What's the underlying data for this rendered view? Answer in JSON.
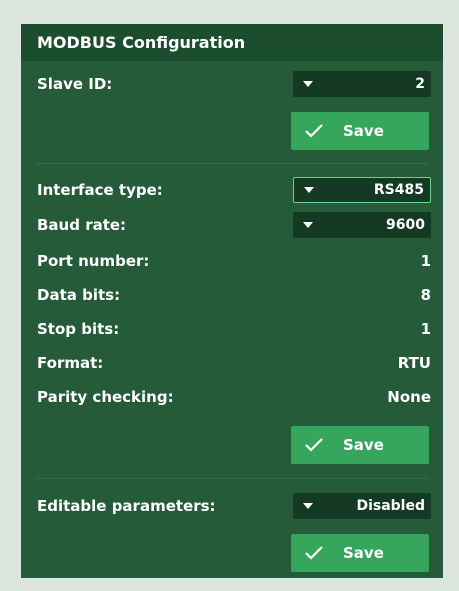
{
  "panel": {
    "title": "MODBUS Configuration"
  },
  "slave": {
    "label": "Slave ID:",
    "value": "2",
    "save_label": "Save"
  },
  "interface": {
    "type_label": "Interface type:",
    "type_value": "RS485",
    "baud_label": "Baud rate:",
    "baud_value": "9600",
    "port_label": "Port number:",
    "port_value": "1",
    "databits_label": "Data bits:",
    "databits_value": "8",
    "stopbits_label": "Stop bits:",
    "stopbits_value": "1",
    "format_label": "Format:",
    "format_value": "RTU",
    "parity_label": "Parity checking:",
    "parity_value": "None",
    "save_label": "Save"
  },
  "editable": {
    "label": "Editable parameters:",
    "value": "Disabled",
    "save_label": "Save"
  },
  "colors": {
    "panel": "#255b39",
    "header": "#1d4d2f",
    "select": "#153a24",
    "button": "#36a65d"
  }
}
